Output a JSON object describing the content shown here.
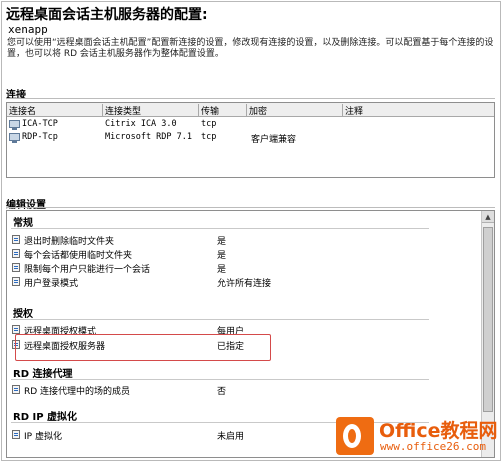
{
  "page": {
    "title": "远程桌面会话主机服务器的配置:",
    "server_name": "xenapp",
    "description": "您可以使用“远程桌面会话主机配置”配置新连接的设置，修改现有连接的设置，以及删除连接。可以配置基于每个连接的设置，也可以将 RD 会话主机服务器作为整体配置设置。"
  },
  "connections": {
    "heading": "连接",
    "columns": [
      "连接名",
      "连接类型",
      "传输",
      "加密",
      "注释"
    ],
    "rows": [
      {
        "name": "ICA-TCP",
        "type": "Citrix ICA 3.0",
        "transport": "tcp",
        "encryption": "",
        "comment": ""
      },
      {
        "name": "RDP-Tcp",
        "type": "Microsoft RDP 7.1",
        "transport": "tcp",
        "encryption": "客户端兼容",
        "comment": ""
      }
    ]
  },
  "edit_settings": {
    "heading": "编辑设置",
    "groups": [
      {
        "title": "常规",
        "items": [
          {
            "label": "退出时删除临时文件夹",
            "value": "是"
          },
          {
            "label": "每个会话都使用临时文件夹",
            "value": "是"
          },
          {
            "label": "限制每个用户只能进行一个会话",
            "value": "是"
          },
          {
            "label": "用户登录模式",
            "value": "允许所有连接"
          }
        ]
      },
      {
        "title": "授权",
        "items": [
          {
            "label": "远程桌面授权模式",
            "value": "每用户"
          },
          {
            "label": "远程桌面授权服务器",
            "value": "已指定"
          }
        ]
      },
      {
        "title": "RD 连接代理",
        "items": [
          {
            "label": "RD 连接代理中的场的成员",
            "value": "否"
          }
        ]
      },
      {
        "title": "RD IP 虚拟化",
        "items": [
          {
            "label": "IP 虚拟化",
            "value": "未启用"
          }
        ]
      }
    ]
  },
  "watermark": {
    "brand": "Office教程网",
    "url": "www.office26.com"
  },
  "colors": {
    "highlight_border": "#d44a4a",
    "logo_orange": "#ef6c12"
  }
}
